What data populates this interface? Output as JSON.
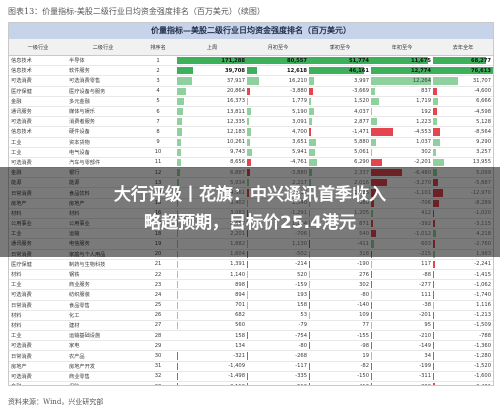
{
  "caption": "图表13：价量指标-美股二级行业日均资金强度排名（百万美元）（续图）",
  "table_title": "价量指标—美股二级行业日均资金强度排名（百万美元）",
  "headers": [
    "一级行业",
    "二级行业",
    "排序名",
    "上周",
    "月初至今",
    "季初至今",
    "年初至今",
    "去年全年"
  ],
  "rows": [
    [
      "信息技术",
      "半导体",
      "1",
      "171,288",
      "80,557",
      "51,774",
      "11,675",
      "68,277"
    ],
    [
      "信息技术",
      "软件服务",
      "2",
      "39,708",
      "12,618",
      "46,161",
      "12,774",
      "76,613"
    ],
    [
      "可选消费",
      "可选消费零售",
      "3",
      "37,917",
      "16,210",
      "3,997",
      "12,264",
      "31,707"
    ],
    [
      "医疗保健",
      "医疗设备与服务",
      "4",
      "20,864",
      "-3,880",
      "-3,669",
      "837",
      "-4,600"
    ],
    [
      "金融",
      "多元金融",
      "5",
      "16,373",
      "1,779",
      "1,520",
      "1,719",
      "6,666"
    ],
    [
      "通讯服务",
      "媒体与娱乐",
      "6",
      "13,811",
      "5,190",
      "4,037",
      "192",
      "-4,598"
    ],
    [
      "可选消费",
      "消费者服务",
      "7",
      "12,335",
      "3,091",
      "2,877",
      "1,223",
      "5,128"
    ],
    [
      "信息技术",
      "硬件设备",
      "8",
      "12,183",
      "4,700",
      "-1,471",
      "-4,553",
      "-8,564"
    ],
    [
      "工业",
      "资本货物",
      "9",
      "10,261",
      "3,651",
      "5,880",
      "1,037",
      "9,290"
    ],
    [
      "工业",
      "电气设备",
      "10",
      "9,743",
      "5,941",
      "5,061",
      "302",
      "3,257"
    ],
    [
      "可选消费",
      "汽车与零部件",
      "11",
      "8,656",
      "-4,761",
      "6,290",
      "-2,201",
      "13,955"
    ],
    [
      "金融",
      "银行",
      "12",
      "6,887",
      "-3,880",
      "2,337",
      "-6,480",
      "5,099"
    ],
    [
      "能源",
      "能源",
      "13",
      "5,934",
      "2,217",
      "2,016",
      "-3,270",
      "-5,887"
    ],
    [
      "日常消费",
      "食品饮料",
      "14",
      "4,561",
      "-2,017",
      "1,025",
      "-1,101",
      "-12,970"
    ],
    [
      "房地产",
      "房地产",
      "15",
      "3,402",
      "1,540",
      "988",
      "-706",
      "-8,289"
    ],
    [
      "材料",
      "材料",
      "16",
      "3,082",
      "-1,291",
      "1,205",
      "412",
      "-1,020"
    ],
    [
      "公用事业",
      "公用事业",
      "17",
      "2,657",
      "1,104",
      "871",
      "-392",
      "-3,115"
    ],
    [
      "工业",
      "运输",
      "18",
      "2,201",
      "-706",
      "540",
      "-1,012",
      "4,218"
    ],
    [
      "通讯服务",
      "电信服务",
      "19",
      "1,882",
      "1,130",
      "-411",
      "603",
      "-2,760"
    ],
    [
      "日常消费",
      "家庭与个人用品",
      "20",
      "1,604",
      "-502",
      "318",
      "-215",
      "1,983"
    ],
    [
      "医疗保健",
      "制药与生物科技",
      "21",
      "1,391",
      "-214",
      "-190",
      "117",
      "-2,241"
    ],
    [
      "材料",
      "钢铁",
      "22",
      "1,140",
      "520",
      "276",
      "-88",
      "-1,415"
    ],
    [
      "工业",
      "商业服务",
      "23",
      "898",
      "-159",
      "302",
      "-277",
      "-1,062"
    ],
    [
      "可选消费",
      "纺织服装",
      "24",
      "894",
      "193",
      "-80",
      "111",
      "-1,740"
    ],
    [
      "日常消费",
      "食品零售",
      "25",
      "701",
      "158",
      "-140",
      "-38",
      "1,116"
    ],
    [
      "材料",
      "化工",
      "26",
      "682",
      "53",
      "109",
      "-201",
      "-1,213"
    ],
    [
      "材料",
      "建材",
      "27",
      "560",
      "-79",
      "77",
      "95",
      "-1,509"
    ],
    [
      "工业",
      "运输基础设施",
      "28",
      "158",
      "-754",
      "-155",
      "-210",
      "-788"
    ],
    [
      "可选消费",
      "家电",
      "29",
      "134",
      "-80",
      "-98",
      "-149",
      "-1,360"
    ],
    [
      "日常消费",
      "农产品",
      "30",
      "-321",
      "-268",
      "19",
      "34",
      "-1,280"
    ],
    [
      "房地产",
      "房地产开发",
      "31",
      "-1,409",
      "-117",
      "-82",
      "-199",
      "-1,520"
    ],
    [
      "可选消费",
      "商业零售",
      "32",
      "-1,498",
      "-335",
      "-150",
      "-311",
      "-1,600"
    ],
    [
      "金融",
      "保险",
      "33",
      "-2,110",
      "-510",
      "-412",
      "-290",
      "-2,431"
    ]
  ],
  "headline_line1": "大行评级丨花旗：中兴通讯首季收入",
  "headline_line2": "略超预期，目标价25.4港元",
  "source": "资料来源：Wind，兴业研究部",
  "colors": {
    "positive": "#8fd19e",
    "negative": "#e4454f",
    "header_band": "#c6d3e8"
  }
}
